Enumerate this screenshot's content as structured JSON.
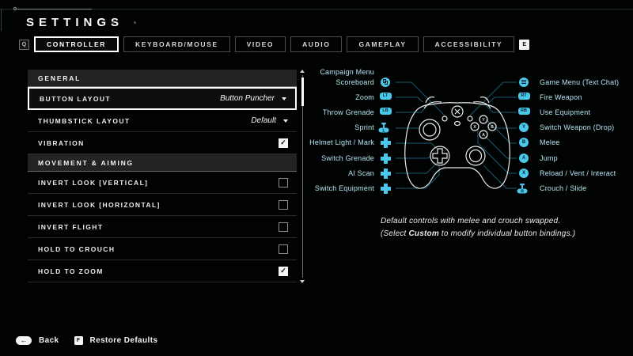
{
  "title": "SETTINGS",
  "tab_bar": {
    "prev_key": "Q",
    "next_key": "E",
    "tabs": [
      {
        "label": "CONTROLLER",
        "active": true
      },
      {
        "label": "KEYBOARD/MOUSE",
        "active": false
      },
      {
        "label": "VIDEO",
        "active": false
      },
      {
        "label": "AUDIO",
        "active": false
      },
      {
        "label": "GAMEPLAY",
        "active": false
      },
      {
        "label": "ACCESSIBILITY",
        "active": false
      }
    ]
  },
  "settings_panel": {
    "sections": [
      {
        "header": "GENERAL",
        "rows": [
          {
            "label": "BUTTON LAYOUT",
            "control": "dropdown",
            "value": "Button Puncher",
            "selected": true
          },
          {
            "label": "THUMBSTICK LAYOUT",
            "control": "dropdown",
            "value": "Default",
            "selected": false
          },
          {
            "label": "VIBRATION",
            "control": "checkbox",
            "checked": true,
            "selected": false
          }
        ]
      },
      {
        "header": "MOVEMENT & AIMING",
        "rows": [
          {
            "label": "INVERT LOOK [VERTICAL]",
            "control": "checkbox",
            "checked": false,
            "selected": false
          },
          {
            "label": "INVERT LOOK [HORIZONTAL]",
            "control": "checkbox",
            "checked": false,
            "selected": false
          },
          {
            "label": "INVERT FLIGHT",
            "control": "checkbox",
            "checked": false,
            "selected": false
          },
          {
            "label": "HOLD TO CROUCH",
            "control": "checkbox",
            "checked": false,
            "selected": false
          },
          {
            "label": "HOLD TO ZOOM",
            "control": "checkbox",
            "checked": true,
            "selected": false
          }
        ]
      }
    ]
  },
  "controller_diagram": {
    "left_bindings": [
      {
        "icon": "view-button",
        "icon_text": "",
        "labels": [
          "Campaign Menu",
          "Scoreboard"
        ]
      },
      {
        "icon": "pill",
        "icon_text": "LT",
        "labels": [
          "Zoom"
        ]
      },
      {
        "icon": "pill",
        "icon_text": "LB",
        "labels": [
          "Throw Grenade"
        ]
      },
      {
        "icon": "stick",
        "icon_text": "L",
        "labels": [
          "Sprint"
        ]
      },
      {
        "icon": "dpad",
        "icon_text": "",
        "labels": [
          "Helmet Light / Mark"
        ]
      },
      {
        "icon": "dpad",
        "icon_text": "",
        "labels": [
          "Switch Grenade"
        ]
      },
      {
        "icon": "dpad",
        "icon_text": "",
        "labels": [
          "AI Scan"
        ]
      },
      {
        "icon": "dpad",
        "icon_text": "",
        "labels": [
          "Switch Equipment"
        ]
      }
    ],
    "right_bindings": [
      {
        "icon": "menu-button",
        "icon_text": "",
        "labels": [
          "Game Menu (Text Chat)"
        ]
      },
      {
        "icon": "pill",
        "icon_text": "RT",
        "labels": [
          "Fire Weapon"
        ]
      },
      {
        "icon": "pill",
        "icon_text": "RB",
        "labels": [
          "Use Equipment"
        ]
      },
      {
        "icon": "face-button",
        "icon_text": "Y",
        "labels": [
          "Switch Weapon (Drop)"
        ]
      },
      {
        "icon": "face-button",
        "icon_text": "B",
        "labels": [
          "Melee"
        ]
      },
      {
        "icon": "face-button",
        "icon_text": "A",
        "labels": [
          "Jump"
        ]
      },
      {
        "icon": "face-button",
        "icon_text": "X",
        "labels": [
          "Reload / Vent / Interact"
        ]
      },
      {
        "icon": "stick",
        "icon_text": "R",
        "labels": [
          "Crouch / Slide"
        ]
      }
    ],
    "notes": {
      "line1": "Default controls with melee and crouch swapped.",
      "line2_prefix": "(Select ",
      "line2_bold": "Custom",
      "line2_suffix": " to modify individual button bindings.)"
    }
  },
  "footer": {
    "back": {
      "key": "←",
      "label": "Back"
    },
    "restore": {
      "key": "F",
      "label": "Restore Defaults"
    }
  },
  "colors": {
    "accent_cyan": "#4ac7e9",
    "label_cyan": "#b5e6f2",
    "connector_teal": "#1a5a70",
    "selected_border": "#ffffff",
    "background": "#010202"
  }
}
